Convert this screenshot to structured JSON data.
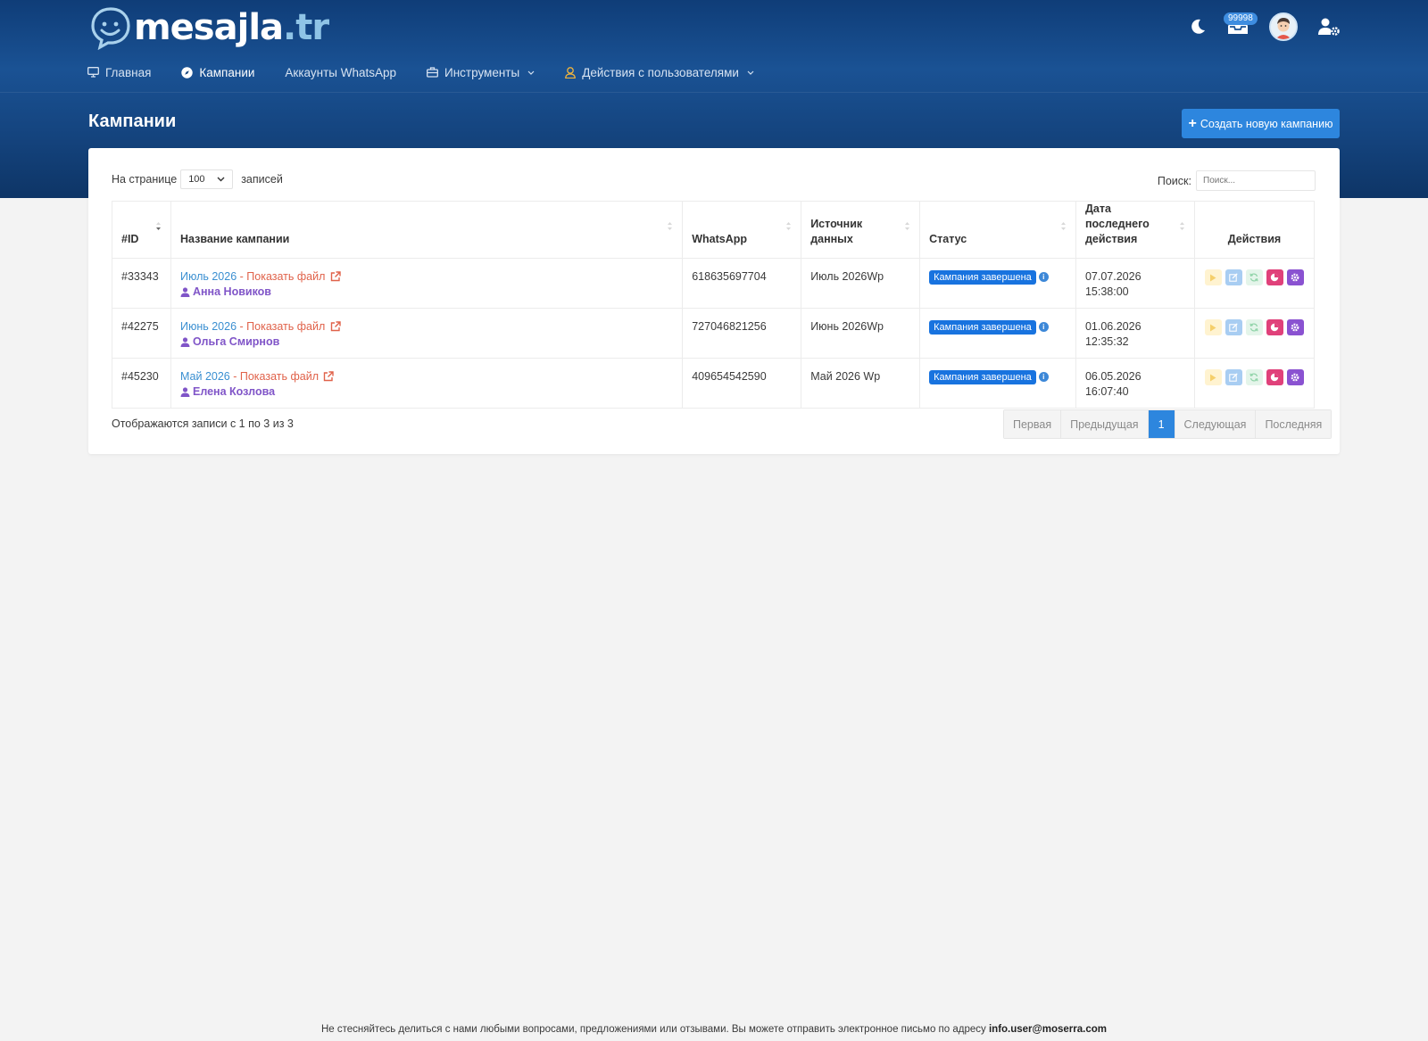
{
  "brand": {
    "name": "mesajla",
    "tld": ".tr"
  },
  "topbar": {
    "notification_count": "99998"
  },
  "nav": {
    "items": [
      {
        "label": "Главная"
      },
      {
        "label": "Кампании"
      },
      {
        "label": "Аккаунты WhatsApp"
      },
      {
        "label": "Инструменты"
      },
      {
        "label": "Действия с пользователями"
      }
    ]
  },
  "page": {
    "title": "Кампании",
    "create_button": "Создать новую кампанию"
  },
  "table_controls": {
    "length_prefix": "На странице",
    "length_value": "100",
    "length_suffix": "записей",
    "search_label": "Поиск:",
    "search_placeholder": "Поиск..."
  },
  "table": {
    "headers": {
      "id": "#ID",
      "name": "Название кампании",
      "whatsapp": "WhatsApp",
      "source": "Источник данных",
      "status": "Статус",
      "last_action": "Дата последнего действия",
      "actions": "Действия"
    },
    "rows": [
      {
        "id": "#33343",
        "campaign": "Июль 2026",
        "separator": " - ",
        "file": "Показать файл",
        "owner": "Анна Новиков",
        "whatsapp": "618635697704",
        "source": "Июль 2026Wp",
        "status": "Кампания завершена",
        "date": "07.07.2026 15:38:00"
      },
      {
        "id": "#42275",
        "campaign": "Июнь 2026",
        "separator": " - ",
        "file": "Показать файл",
        "owner": "Ольга Смирнов",
        "whatsapp": "727046821256",
        "source": "Июнь 2026Wp",
        "status": "Кампания завершена",
        "date": "01.06.2026 12:35:32"
      },
      {
        "id": "#45230",
        "campaign": "Май 2026",
        "separator": " - ",
        "file": "Показать файл",
        "owner": "Елена Козлова",
        "whatsapp": "409654542590",
        "source": "Май 2026 Wp",
        "status": "Кампания завершена",
        "date": "06.05.2026 16:07:40"
      }
    ],
    "info": "Отображаются записи с 1 по 3 из 3"
  },
  "pagination": {
    "first": "Первая",
    "previous": "Предыдущая",
    "current": "1",
    "next": "Следующая",
    "last": "Последняя"
  },
  "footer": {
    "text": "Не стесняйтесь делиться с нами любыми вопросами, предложениями или отзывами. Вы можете отправить электронное письмо по адресу ",
    "email": "info.user@moserra.com"
  },
  "colors": {
    "header_bg": "#14437d",
    "primary": "#2d86de",
    "status_badge": "#1873df",
    "owner_link": "#8055c8",
    "file_link": "#e0624a"
  }
}
